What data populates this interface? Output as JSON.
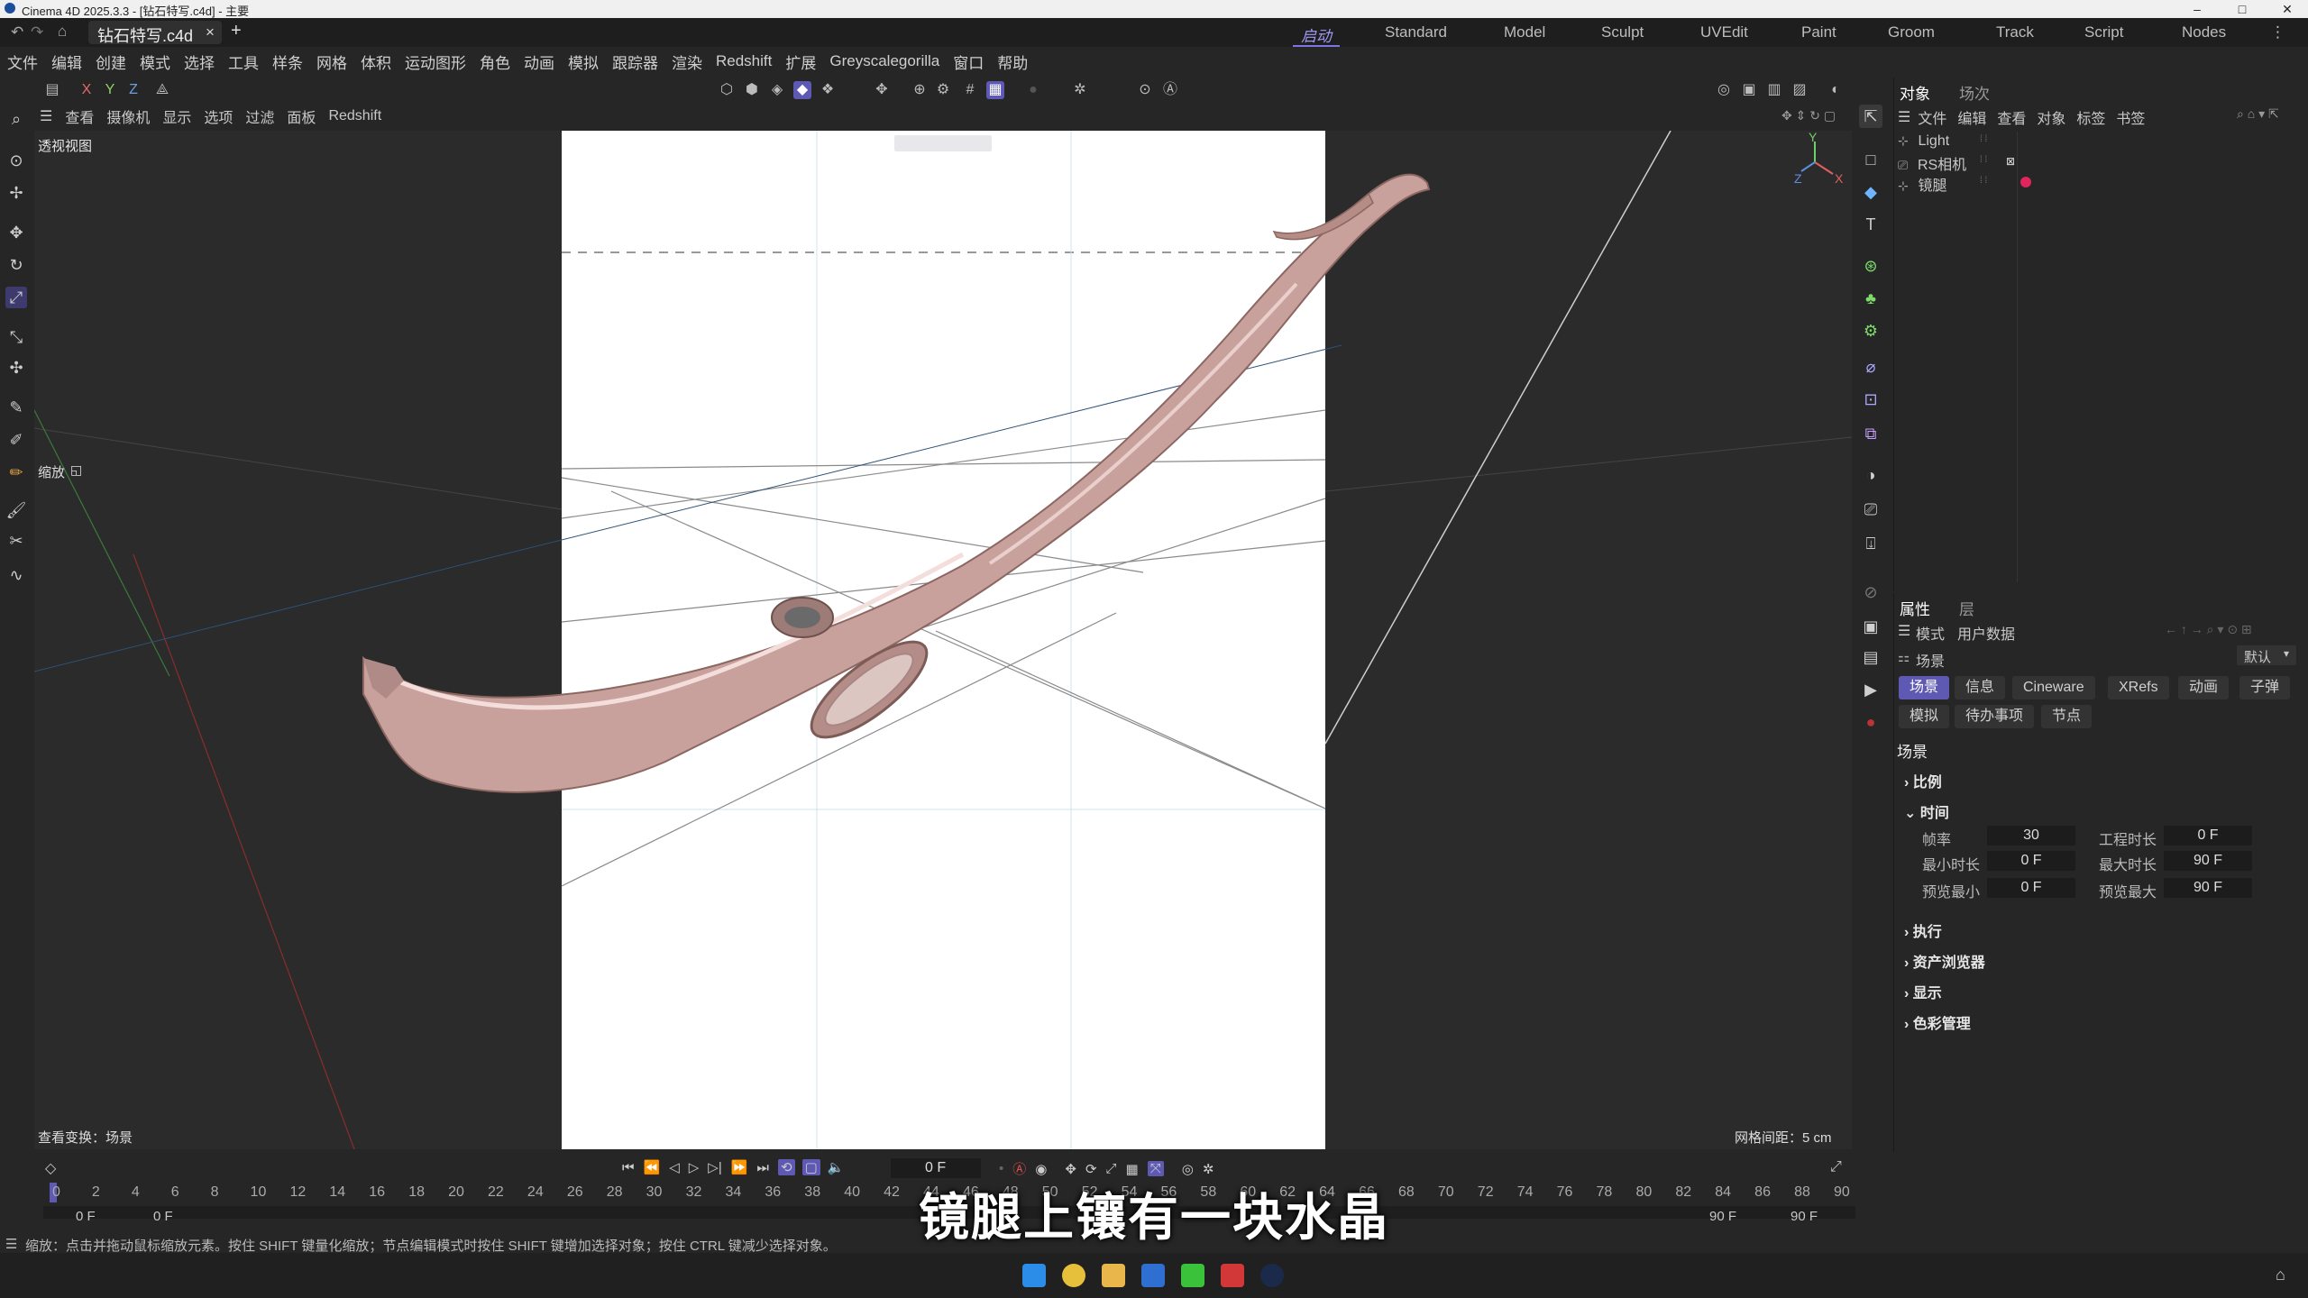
{
  "window": {
    "title": "Cinema 4D 2025.3.3 - [钻石特写.c4d] - 主要",
    "controls": [
      "–",
      "□",
      "✕"
    ]
  },
  "tabrow": {
    "file_tab": "钻石特写.c4d",
    "close": "×",
    "add": "+",
    "layouts": [
      "启动",
      "Standard",
      "Model",
      "Sculpt",
      "UVEdit",
      "Paint",
      "Groom",
      "Track",
      "Script",
      "Nodes"
    ],
    "active_layout": "启动"
  },
  "menu": [
    "文件",
    "编辑",
    "创建",
    "模式",
    "选择",
    "工具",
    "样条",
    "网格",
    "体积",
    "运动图形",
    "角色",
    "动画",
    "模拟",
    "跟踪器",
    "渲染",
    "Redshift",
    "扩展",
    "Greyscalegorilla",
    "窗口",
    "帮助"
  ],
  "axis_toggles": [
    "X",
    "Y",
    "Z"
  ],
  "viewport": {
    "header_items": [
      "查看",
      "摄像机",
      "显示",
      "选项",
      "过滤",
      "面板",
      "Redshift"
    ],
    "name": "透视视图",
    "zoom_label": "缩放",
    "status_left": "查看变换：场景",
    "grid_spacing": "网格间距：5 cm"
  },
  "object_manager": {
    "tabs": [
      "对象",
      "场次"
    ],
    "menu": [
      "文件",
      "编辑",
      "查看",
      "对象",
      "标签",
      "书签"
    ],
    "objects": [
      {
        "name": "Light",
        "icon": "light-icon"
      },
      {
        "name": "RS相机",
        "icon": "camera-icon"
      },
      {
        "name": "镜腿",
        "icon": "null-icon"
      }
    ]
  },
  "attributes": {
    "tabs": [
      "属性",
      "层"
    ],
    "menu": [
      "模式",
      "用户数据"
    ],
    "context": "场景",
    "preset": "默认",
    "chips_row1": [
      "场景",
      "信息",
      "Cineware",
      "XRefs",
      "动画",
      "子弹"
    ],
    "chips_row2": [
      "模拟",
      "待办事项",
      "节点"
    ],
    "active_chip": "场景",
    "section_title": "场景",
    "groups": {
      "scale": "比例",
      "time": "时间",
      "exec": "执行",
      "assets": "资产浏览器",
      "display": "显示",
      "color": "色彩管理"
    },
    "fields": {
      "fps_label": "帧率",
      "fps": "30",
      "proj_len_label": "工程时长",
      "proj_len": "0 F",
      "min_len_label": "最小时长",
      "min_len": "0 F",
      "max_len_label": "最大时长",
      "max_len": "90 F",
      "prev_min_label": "预览最小",
      "prev_min": "0 F",
      "prev_max_label": "预览最大",
      "prev_max": "90 F"
    }
  },
  "timeline": {
    "current_frame": "0 F",
    "ticks": [
      "0",
      "2",
      "4",
      "6",
      "8",
      "10",
      "12",
      "14",
      "16",
      "18",
      "20",
      "22",
      "24",
      "26",
      "28",
      "30",
      "32",
      "34",
      "36",
      "38",
      "40",
      "42",
      "44",
      "46",
      "48",
      "50",
      "52",
      "54",
      "56",
      "58",
      "60",
      "62",
      "64",
      "66",
      "68",
      "70",
      "72",
      "74",
      "76",
      "78",
      "80",
      "82",
      "84",
      "86",
      "88",
      "90"
    ],
    "start_a": "0 F",
    "start_b": "0 F",
    "end_a": "90 F",
    "end_b": "90 F"
  },
  "status_bar": "缩放：点击并拖动鼠标缩放元素。按住 SHIFT 键量化缩放；节点编辑模式时按住 SHIFT 键增加选择对象；按住 CTRL 键减少选择对象。",
  "subtitle": "镜腿上镶有一块水晶",
  "colors": {
    "accent": "#5e59b3",
    "model": "#c99a94",
    "paper": "#ffffff",
    "bg": "#262626"
  }
}
